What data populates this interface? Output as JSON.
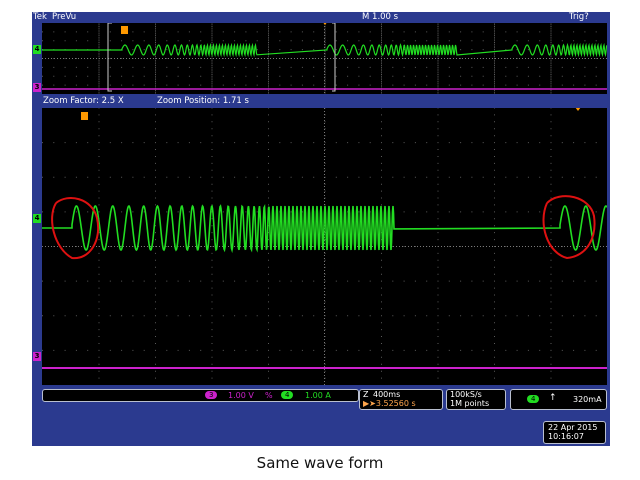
{
  "app": {
    "brand": "Tek",
    "mode": "PreVu",
    "timebase": "M 1.00 s",
    "trigger_status": "Trig?"
  },
  "zoom": {
    "factor": "Zoom Factor: 2.5 X",
    "position": "Zoom Position: 1.71 s"
  },
  "markers": {
    "trigger": "T",
    "ch4": "4",
    "ch3": "3"
  },
  "vertical": {
    "ch3_scale": "1.00 V",
    "ch4_label": "4",
    "ch3_label": "3",
    "ch4_scale": "1.00 A",
    "ch4_unit_symbol": "%"
  },
  "horizontal": {
    "scale": "400ms",
    "delay": "▶➤3.52560 s",
    "zoom_icon": "Z"
  },
  "acquisition": {
    "rate": "100kS/s",
    "points": "1M points"
  },
  "trigger": {
    "channel": "4",
    "slope": "↑",
    "level": "320mA"
  },
  "datetime": {
    "date": "22 Apr  2015",
    "time": "10:16:07"
  },
  "caption": "Same wave form",
  "colors": {
    "ch4": "#22dd22",
    "ch3": "#cc22cc",
    "annotation": "#dd1111",
    "frame": "#2b3a8f"
  }
}
